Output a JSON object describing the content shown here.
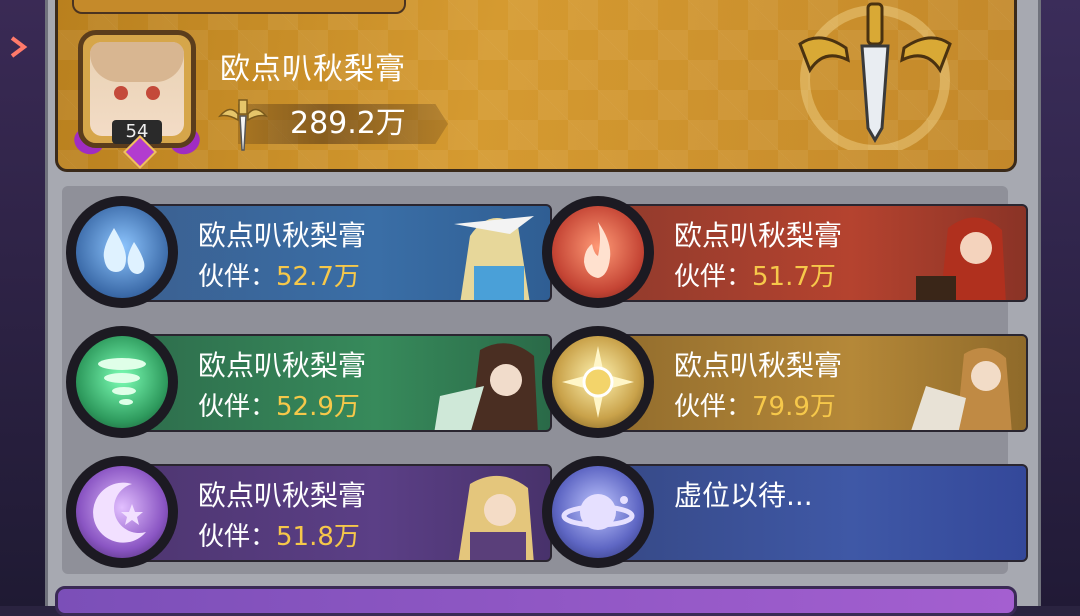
{
  "player": {
    "name": "欧点叭秋梨膏",
    "level": "54",
    "power": "289.2万"
  },
  "cards": [
    {
      "element": "water",
      "name": "欧点叭秋梨膏",
      "partner_label": "伙伴：",
      "partner_value": "52.7万"
    },
    {
      "element": "fire",
      "name": "欧点叭秋梨膏",
      "partner_label": "伙伴：",
      "partner_value": "51.7万"
    },
    {
      "element": "wind",
      "name": "欧点叭秋梨膏",
      "partner_label": "伙伴：",
      "partner_value": "52.9万"
    },
    {
      "element": "sun",
      "name": "欧点叭秋梨膏",
      "partner_label": "伙伴：",
      "partner_value": "79.9万"
    },
    {
      "element": "moon",
      "name": "欧点叭秋梨膏",
      "partner_label": "伙伴：",
      "partner_value": "51.8万"
    },
    {
      "element": "planet",
      "name": "虚位以待..."
    }
  ],
  "colors": {
    "gold_value": "#f6c84a",
    "banner": "#d59a30"
  },
  "icons": [
    "arrow-right-icon",
    "sword-icon",
    "sword-emblem-icon",
    "water-drop-icon",
    "fire-icon",
    "tornado-icon",
    "sun-icon",
    "crescent-moon-icon",
    "planet-icon"
  ]
}
